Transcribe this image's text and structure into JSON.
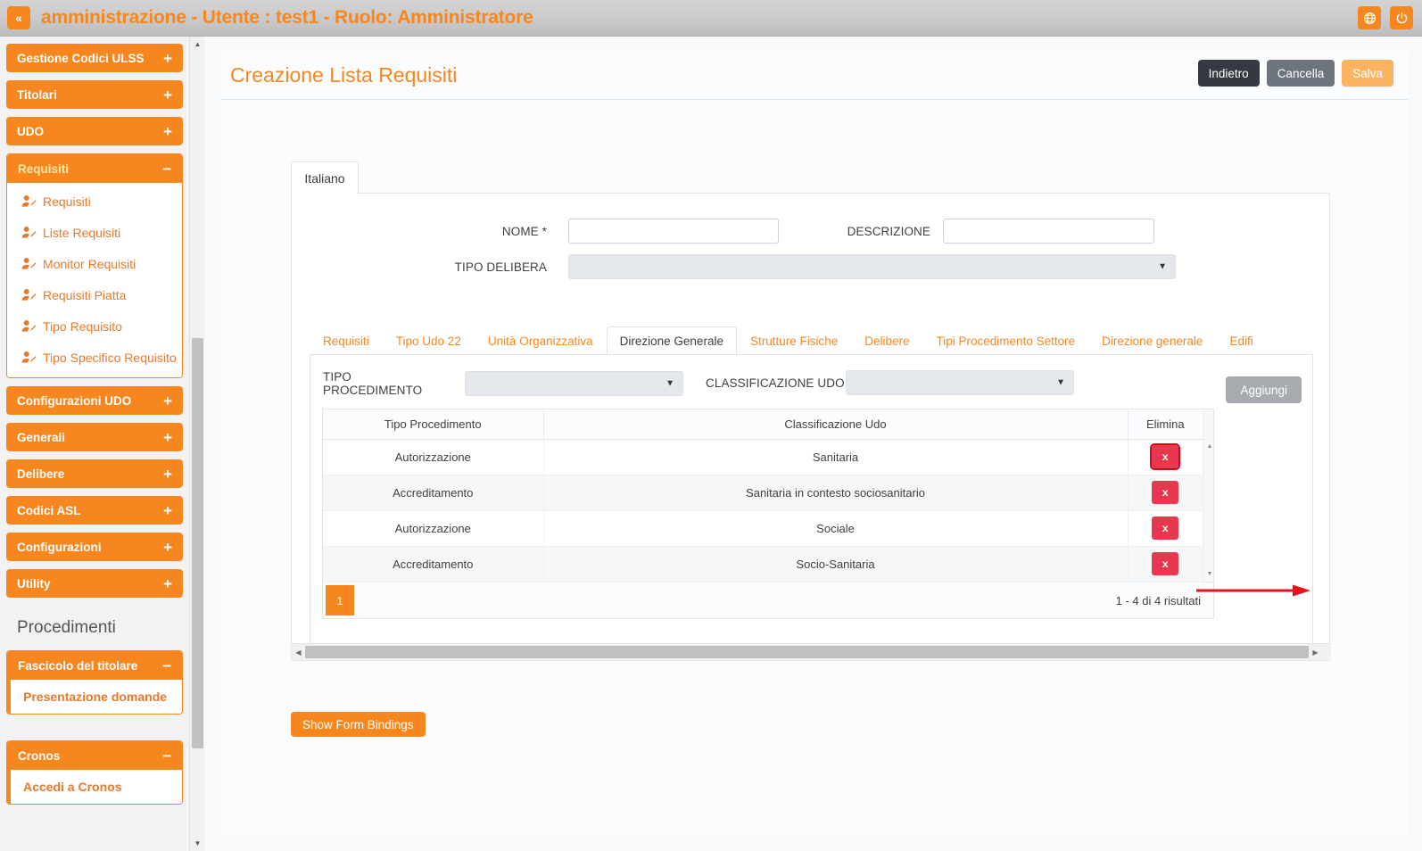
{
  "topbar": {
    "collapse_icon": "double-chevron-left-icon",
    "title": "amministrazione - Utente : test1 - Ruolo: Amministratore",
    "language_icon": "globe-icon",
    "logout_icon": "power-icon"
  },
  "colors": {
    "brand_orange": "#f6871f",
    "danger_red": "#e8384f",
    "dark_button": "#343a40",
    "grey_button": "#6c757d",
    "save_button": "#fbb361",
    "annotation_arrow": "#e8111e"
  },
  "sidebar": {
    "groups": [
      {
        "label": "Gestione Codici ULSS",
        "sign": "+",
        "expanded": false
      },
      {
        "label": "Titolari",
        "sign": "+",
        "expanded": false
      },
      {
        "label": "UDO",
        "sign": "+",
        "expanded": false
      },
      {
        "label": "Requisiti",
        "sign": "−",
        "expanded": true,
        "items": [
          {
            "label": "Requisiti",
            "icon": "user-edit-icon"
          },
          {
            "label": "Liste Requisiti",
            "icon": "user-edit-icon"
          },
          {
            "label": "Monitor Requisiti",
            "icon": "user-edit-icon"
          },
          {
            "label": "Requisiti Piatta",
            "icon": "user-edit-icon"
          },
          {
            "label": "Tipo Requisito",
            "icon": "user-edit-icon"
          },
          {
            "label": "Tipo Specifico Requisito",
            "icon": "user-edit-icon"
          }
        ]
      },
      {
        "label": "Configurazioni UDO",
        "sign": "+",
        "expanded": false
      },
      {
        "label": "Generali",
        "sign": "+",
        "expanded": false
      },
      {
        "label": "Delibere",
        "sign": "+",
        "expanded": false
      },
      {
        "label": "Codici ASL",
        "sign": "+",
        "expanded": false
      },
      {
        "label": "Configurazioni",
        "sign": "+",
        "expanded": false
      },
      {
        "label": "Utility",
        "sign": "+",
        "expanded": false
      }
    ],
    "section_title": "Procedimenti",
    "fascicolo": {
      "label": "Fascicolo del titolare",
      "sign": "−",
      "item": "Presentazione domande"
    },
    "cronos": {
      "label": "Cronos",
      "sign": "−",
      "item": "Accedi a Cronos"
    }
  },
  "header": {
    "title": "Creazione Lista Requisiti",
    "buttons": [
      {
        "label": "Indietro",
        "style": "dark"
      },
      {
        "label": "Cancella",
        "style": "grey"
      },
      {
        "label": "Salva",
        "style": "orange"
      }
    ]
  },
  "lang_tab": {
    "label": "Italiano"
  },
  "form": {
    "nome_label": "NOME *",
    "nome_value": "",
    "descrizione_label": "DESCRIZIONE",
    "descrizione_value": "",
    "tipo_delibera_label": "TIPO DELIBERA",
    "tipo_delibera_value": "",
    "caret_icon": "chevron-down-icon"
  },
  "inner_tabs": [
    {
      "label": "Requisiti",
      "active": false
    },
    {
      "label": "Tipo Udo 22",
      "active": false
    },
    {
      "label": "Unità Organizzativa",
      "active": false
    },
    {
      "label": "Direzione Generale",
      "active": true
    },
    {
      "label": "Strutture Fisiche",
      "active": false
    },
    {
      "label": "Delibere",
      "active": false
    },
    {
      "label": "Tipi Procedimento Settore",
      "active": false
    },
    {
      "label": "Direzione generale",
      "active": false
    },
    {
      "label": "Edifi",
      "active": false
    }
  ],
  "filter": {
    "tipo_procedimento_label": "TIPO PROCEDIMENTO",
    "tipo_procedimento_value": "",
    "classificazione_udo_label": "CLASSIFICAZIONE UDO",
    "classificazione_udo_value": "",
    "add_button": "Aggiungi"
  },
  "grid": {
    "columns": [
      "Tipo Procedimento",
      "Classificazione Udo",
      "Elimina"
    ],
    "delete_label": "x",
    "rows": [
      {
        "tipo": "Autorizzazione",
        "classificazione": "Sanitaria",
        "highlighted": true
      },
      {
        "tipo": "Accreditamento",
        "classificazione": "Sanitaria in contesto sociosanitario",
        "highlighted": false
      },
      {
        "tipo": "Autorizzazione",
        "classificazione": "Sociale",
        "highlighted": false
      },
      {
        "tipo": "Accreditamento",
        "classificazione": "Socio-Sanitaria",
        "highlighted": false
      }
    ]
  },
  "pager": {
    "current_page": "1",
    "results_text": "1 - 4 di 4 risultati"
  },
  "footer": {
    "show_bindings": "Show Form Bindings"
  },
  "scroll_icons": {
    "up": "▲",
    "down": "▼",
    "left": "◀",
    "right": "▶"
  }
}
